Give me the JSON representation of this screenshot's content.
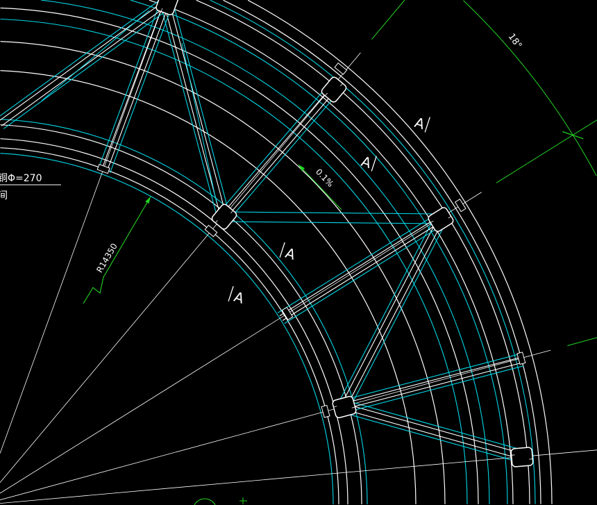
{
  "colors": {
    "background": "#000000",
    "structure": "#ffffff",
    "edge": "#00d7e6",
    "dimension": "#22d422"
  },
  "labels": {
    "section_marks": [
      "A",
      "A",
      "A",
      "A"
    ],
    "slope": "0.1%",
    "radius": "R14350",
    "angle": "18°",
    "note_line1": "铜Φ=270",
    "note_line2": "间"
  }
}
